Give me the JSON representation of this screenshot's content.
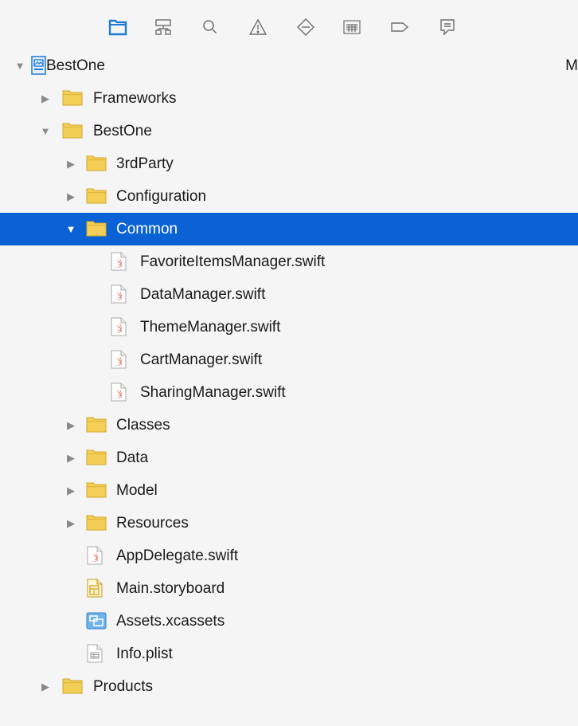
{
  "toolbar": {
    "icons": [
      {
        "name": "project-navigator-icon",
        "active": true
      },
      {
        "name": "symbol-navigator-icon",
        "active": false
      },
      {
        "name": "find-navigator-icon",
        "active": false
      },
      {
        "name": "issue-navigator-icon",
        "active": false
      },
      {
        "name": "test-navigator-icon",
        "active": false
      },
      {
        "name": "debug-navigator-icon",
        "active": false
      },
      {
        "name": "breakpoint-navigator-icon",
        "active": false
      },
      {
        "name": "report-navigator-icon",
        "active": false
      }
    ],
    "accent_color": "#1f7bd8"
  },
  "tree": {
    "column_header": "M",
    "selected_color": "#0a62d4",
    "rows": [
      {
        "label": "BestOne",
        "icon": "project-icon",
        "expandable": true,
        "expanded": true,
        "selected": false,
        "level": 0
      },
      {
        "label": "Frameworks",
        "icon": "folder-icon",
        "expandable": true,
        "expanded": false,
        "selected": false,
        "level": 1
      },
      {
        "label": "BestOne",
        "icon": "folder-icon",
        "expandable": true,
        "expanded": true,
        "selected": false,
        "level": 1
      },
      {
        "label": "3rdParty",
        "icon": "folder-icon",
        "expandable": true,
        "expanded": false,
        "selected": false,
        "level": 2
      },
      {
        "label": "Configuration",
        "icon": "folder-icon",
        "expandable": true,
        "expanded": false,
        "selected": false,
        "level": 2
      },
      {
        "label": "Common",
        "icon": "folder-icon",
        "expandable": true,
        "expanded": true,
        "selected": true,
        "level": 2
      },
      {
        "label": "FavoriteItemsManager.swift",
        "icon": "swift-file-icon",
        "expandable": false,
        "expanded": false,
        "selected": false,
        "level": 3
      },
      {
        "label": "DataManager.swift",
        "icon": "swift-file-icon",
        "expandable": false,
        "expanded": false,
        "selected": false,
        "level": 3
      },
      {
        "label": "ThemeManager.swift",
        "icon": "swift-file-icon",
        "expandable": false,
        "expanded": false,
        "selected": false,
        "level": 3
      },
      {
        "label": "CartManager.swift",
        "icon": "swift-file-icon",
        "expandable": false,
        "expanded": false,
        "selected": false,
        "level": 3
      },
      {
        "label": "SharingManager.swift",
        "icon": "swift-file-icon",
        "expandable": false,
        "expanded": false,
        "selected": false,
        "level": 3
      },
      {
        "label": "Classes",
        "icon": "folder-icon",
        "expandable": true,
        "expanded": false,
        "selected": false,
        "level": 2
      },
      {
        "label": "Data",
        "icon": "folder-icon",
        "expandable": true,
        "expanded": false,
        "selected": false,
        "level": 2
      },
      {
        "label": "Model",
        "icon": "folder-icon",
        "expandable": true,
        "expanded": false,
        "selected": false,
        "level": 2
      },
      {
        "label": "Resources",
        "icon": "folder-icon",
        "expandable": true,
        "expanded": false,
        "selected": false,
        "level": 2
      },
      {
        "label": "AppDelegate.swift",
        "icon": "swift-file-icon",
        "expandable": false,
        "expanded": false,
        "selected": false,
        "level": 2
      },
      {
        "label": "Main.storyboard",
        "icon": "storyboard-file-icon",
        "expandable": false,
        "expanded": false,
        "selected": false,
        "level": 2
      },
      {
        "label": "Assets.xcassets",
        "icon": "asset-catalog-icon",
        "expandable": false,
        "expanded": false,
        "selected": false,
        "level": 2
      },
      {
        "label": "Info.plist",
        "icon": "plist-file-icon",
        "expandable": false,
        "expanded": false,
        "selected": false,
        "level": 2
      },
      {
        "label": "Products",
        "icon": "folder-icon",
        "expandable": true,
        "expanded": false,
        "selected": false,
        "level": 1
      }
    ]
  }
}
